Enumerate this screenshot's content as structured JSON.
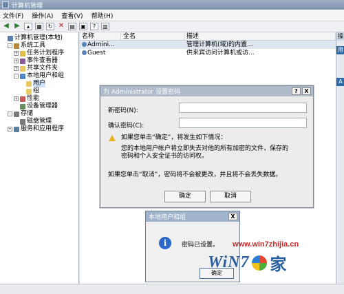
{
  "window": {
    "title": "计算机管理"
  },
  "menu": [
    "文件(F)",
    "操作(A)",
    "查看(V)",
    "帮助(H)"
  ],
  "tree": [
    {
      "label": "计算机管理(本地)",
      "level": 0,
      "exp": "",
      "icon": "computer-icon"
    },
    {
      "label": "系统工具",
      "level": 1,
      "exp": "-",
      "icon": "tools-icon"
    },
    {
      "label": "任务计划程序",
      "level": 2,
      "exp": "+",
      "icon": "clock-icon"
    },
    {
      "label": "事件查看器",
      "level": 2,
      "exp": "+",
      "icon": "event-icon"
    },
    {
      "label": "共享文件夹",
      "level": 2,
      "exp": "+",
      "icon": "folder-icon"
    },
    {
      "label": "本地用户和组",
      "level": 2,
      "exp": "-",
      "icon": "users-icon"
    },
    {
      "label": "用户",
      "level": 3,
      "exp": "",
      "icon": "folder-icon",
      "selected": true
    },
    {
      "label": "组",
      "level": 3,
      "exp": "",
      "icon": "folder-icon"
    },
    {
      "label": "性能",
      "level": 2,
      "exp": "+",
      "icon": "performance-icon"
    },
    {
      "label": "设备管理器",
      "level": 2,
      "exp": "",
      "icon": "device-icon"
    },
    {
      "label": "存储",
      "level": 1,
      "exp": "-",
      "icon": "storage-icon"
    },
    {
      "label": "磁盘管理",
      "level": 2,
      "exp": "",
      "icon": "disk-icon"
    },
    {
      "label": "服务和应用程序",
      "level": 1,
      "exp": "+",
      "icon": "services-icon"
    }
  ],
  "list": {
    "columns": [
      "名称",
      "全名",
      "描述"
    ],
    "rows": [
      {
        "name": "Admini...",
        "fullname": "",
        "desc": "管理计算机(域)的内置..."
      },
      {
        "name": "Guest",
        "fullname": "",
        "desc": "供来宾访问计算机或访..."
      }
    ]
  },
  "actions": {
    "header": "操",
    "item1": "用",
    "item2": "A"
  },
  "password_dialog": {
    "title": "为 Administrator 设置密码",
    "help_btn": "?",
    "close_btn": "X",
    "new_password_label": "新密码(N):",
    "confirm_password_label": "确认密码(C):",
    "warn_title": "如果您单击“确定”，将发生如下情况：",
    "warn_line1": "您的本地用户帐户将立即失去对他的所有加密的文件，保存的",
    "warn_line2": "密码和个人安全证书的访问权。",
    "cancel_note": "如果您单击“取消”，密码将不会被更改，并且将不会丢失数据。",
    "ok": "确定",
    "cancel": "取消"
  },
  "message_box": {
    "title": "本地用户和组",
    "close_btn": "X",
    "text": "密码已设置。",
    "ok": "确定"
  },
  "watermark": {
    "url": "www.win7zhijia.cn",
    "logo": "WiN7",
    "suffix": "家"
  }
}
